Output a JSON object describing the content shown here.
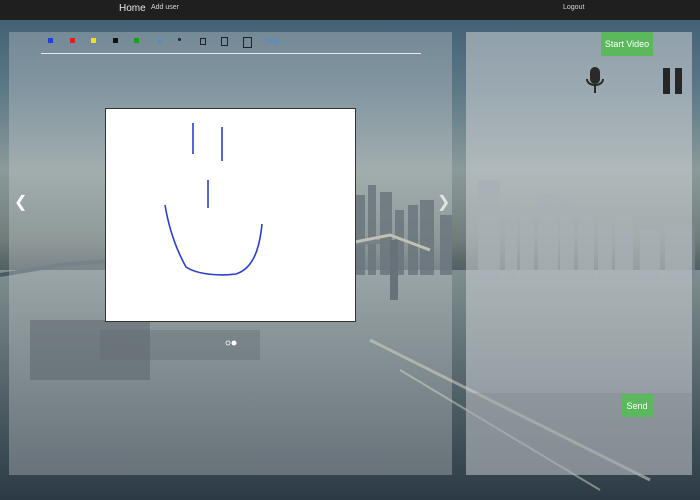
{
  "nav": {
    "home": "Home",
    "add_user": "Add user",
    "logout": "Logout"
  },
  "toolbar": {
    "colors": [
      "#1f3fe0",
      "#e02020",
      "#f5e020",
      "#111111",
      "#18a018"
    ],
    "clear_label": "Clear"
  },
  "video": {
    "start_label": "Start Video"
  },
  "chat": {
    "send_label": "Send"
  },
  "icons": {
    "left": "chevron-left-icon",
    "right": "chevron-right-icon",
    "mic": "microphone-icon",
    "pause": "pause-icon"
  }
}
